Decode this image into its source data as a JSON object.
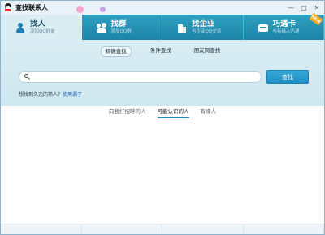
{
  "window": {
    "title": "查找联系人",
    "controls": [
      "minimize",
      "maximize",
      "close"
    ]
  },
  "category_tabs": [
    {
      "name": "找人",
      "sub": "添加QQ好友",
      "icon": "person-icon",
      "active": true
    },
    {
      "name": "找群",
      "sub": "添加QQ群",
      "icon": "group-icon",
      "active": false
    },
    {
      "name": "找企业",
      "sub": "与企业QQ交流",
      "icon": "company-icon",
      "active": false
    },
    {
      "name": "巧遇卡",
      "sub": "与有缘人巧遇",
      "icon": "card-icon",
      "active": false,
      "badge": "NEW"
    }
  ],
  "search": {
    "subtabs": [
      {
        "label": "精确查找",
        "active": true
      },
      {
        "label": "条件查找",
        "active": false
      },
      {
        "label": "朋友网查找",
        "active": false
      }
    ],
    "input_value": "",
    "placeholder": "",
    "button_label": "查找",
    "hint_text": "想找到久违的熟人？",
    "hint_link": "使用漏子"
  },
  "recommend_tabs": [
    {
      "label": "向我打招呼的人",
      "active": false
    },
    {
      "label": "可能认识的人",
      "active": true
    },
    {
      "label": "有缘人",
      "active": false
    }
  ],
  "colors": {
    "tab_bar": "#1c84a8",
    "active_tab": "#d9edf3",
    "search_button": "#1d8ec3",
    "link": "#1a66b8"
  }
}
